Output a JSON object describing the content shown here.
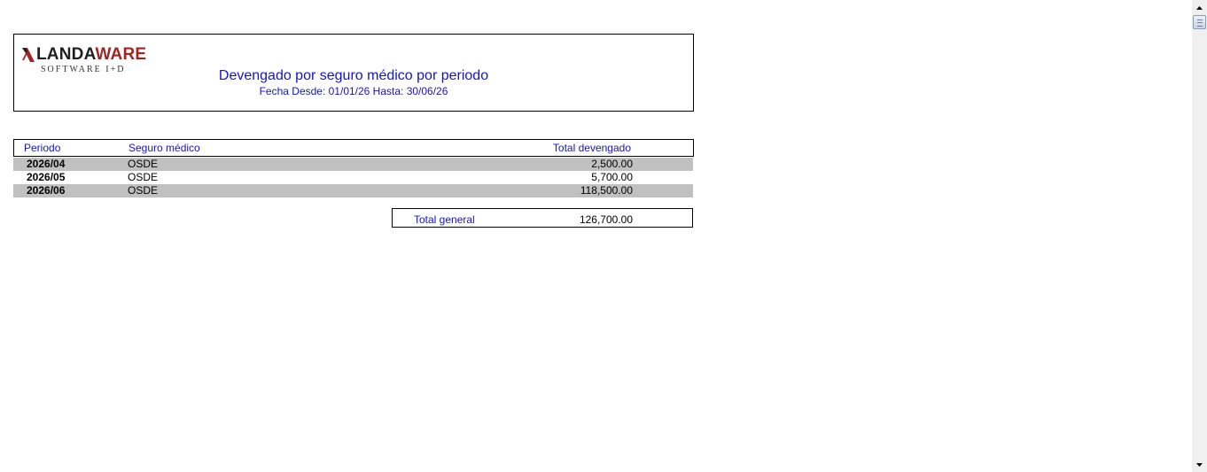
{
  "logo": {
    "brand_dark": "LANDA",
    "brand_red": "WARE",
    "tagline": "SOFTWARE I+D",
    "icon": "landaware-logo-icon"
  },
  "report": {
    "title": "Devengado por seguro médico por periodo",
    "subtitle": "Fecha Desde: 01/01/26 Hasta: 30/06/26"
  },
  "table": {
    "headers": {
      "periodo": "Periodo",
      "seguro": "Seguro médico",
      "total": "Total devengado"
    },
    "rows": [
      {
        "periodo": "2026/04",
        "seguro": "OSDE",
        "total": "2,500.00"
      },
      {
        "periodo": "2026/05",
        "seguro": "OSDE",
        "total": "5,700.00"
      },
      {
        "periodo": "2026/06",
        "seguro": "OSDE",
        "total": "118,500.00"
      }
    ]
  },
  "totals": {
    "label": "Total general",
    "value": "126,700.00"
  },
  "colors": {
    "accent_blue": "#1414c8",
    "brand_red": "#a02424",
    "row_shade": "#c0c0c0"
  },
  "scrollbar": {
    "up_icon": "scroll-up-arrow-icon",
    "down_icon": "scroll-down-arrow-icon"
  }
}
